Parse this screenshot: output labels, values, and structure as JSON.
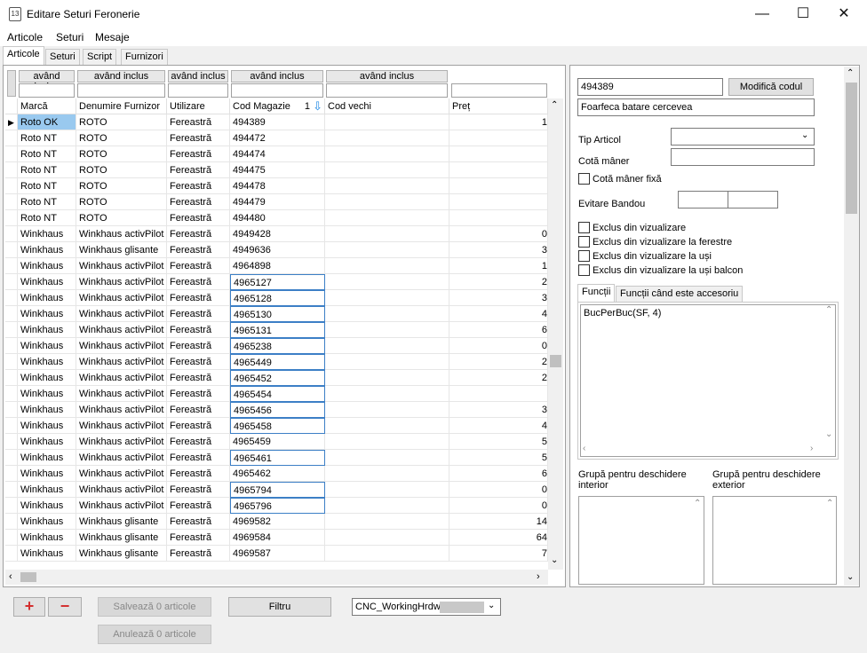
{
  "window": {
    "title": "Editare Seturi Feronerie",
    "icon_text": "13"
  },
  "menu": [
    "Articole",
    "Seturi",
    "Mesaje"
  ],
  "tabs": [
    "Articole",
    "Seturi",
    "Script",
    "Furnizori"
  ],
  "filters": {
    "labels": [
      "având inclus",
      "având inclus",
      "având inclus",
      "având inclus",
      "având inclus"
    ]
  },
  "grid": {
    "columns": [
      "Marcă",
      "Denumire Furnizor",
      "Utilizare",
      "Cod Magazie",
      "Cod vechi",
      "Preț"
    ],
    "sort_indicator": "1",
    "rows": [
      {
        "marca": "Roto OK",
        "furnizor": "ROTO",
        "utilizare": "Fereastră",
        "cod": "494389",
        "vechi": "",
        "pret": "1"
      },
      {
        "marca": "Roto NT",
        "furnizor": "ROTO",
        "utilizare": "Fereastră",
        "cod": "494472",
        "vechi": "",
        "pret": ""
      },
      {
        "marca": "Roto NT",
        "furnizor": "ROTO",
        "utilizare": "Fereastră",
        "cod": "494474",
        "vechi": "",
        "pret": ""
      },
      {
        "marca": "Roto NT",
        "furnizor": "ROTO",
        "utilizare": "Fereastră",
        "cod": "494475",
        "vechi": "",
        "pret": ""
      },
      {
        "marca": "Roto NT",
        "furnizor": "ROTO",
        "utilizare": "Fereastră",
        "cod": "494478",
        "vechi": "",
        "pret": ""
      },
      {
        "marca": "Roto NT",
        "furnizor": "ROTO",
        "utilizare": "Fereastră",
        "cod": "494479",
        "vechi": "",
        "pret": ""
      },
      {
        "marca": "Roto NT",
        "furnizor": "ROTO",
        "utilizare": "Fereastră",
        "cod": "494480",
        "vechi": "",
        "pret": ""
      },
      {
        "marca": "Winkhaus",
        "furnizor": "Winkhaus activPilot",
        "utilizare": "Fereastră",
        "cod": "4949428",
        "vechi": "",
        "pret": "0"
      },
      {
        "marca": "Winkhaus",
        "furnizor": "Winkhaus glisante",
        "utilizare": "Fereastră",
        "cod": "4949636",
        "vechi": "",
        "pret": "3"
      },
      {
        "marca": "Winkhaus",
        "furnizor": "Winkhaus activPilot",
        "utilizare": "Fereastră",
        "cod": "4964898",
        "vechi": "",
        "pret": "1"
      },
      {
        "marca": "Winkhaus",
        "furnizor": "Winkhaus activPilot",
        "utilizare": "Fereastră",
        "cod": "4965127",
        "vechi": "",
        "pret": "2"
      },
      {
        "marca": "Winkhaus",
        "furnizor": "Winkhaus activPilot",
        "utilizare": "Fereastră",
        "cod": "4965128",
        "vechi": "",
        "pret": "3"
      },
      {
        "marca": "Winkhaus",
        "furnizor": "Winkhaus activPilot",
        "utilizare": "Fereastră",
        "cod": "4965130",
        "vechi": "",
        "pret": "4"
      },
      {
        "marca": "Winkhaus",
        "furnizor": "Winkhaus activPilot",
        "utilizare": "Fereastră",
        "cod": "4965131",
        "vechi": "",
        "pret": "6"
      },
      {
        "marca": "Winkhaus",
        "furnizor": "Winkhaus activPilot",
        "utilizare": "Fereastră",
        "cod": "4965238",
        "vechi": "",
        "pret": "0"
      },
      {
        "marca": "Winkhaus",
        "furnizor": "Winkhaus activPilot",
        "utilizare": "Fereastră",
        "cod": "4965449",
        "vechi": "",
        "pret": "2"
      },
      {
        "marca": "Winkhaus",
        "furnizor": "Winkhaus activPilot",
        "utilizare": "Fereastră",
        "cod": "4965452",
        "vechi": "",
        "pret": "2"
      },
      {
        "marca": "Winkhaus",
        "furnizor": "Winkhaus activPilot",
        "utilizare": "Fereastră",
        "cod": "4965454",
        "vechi": "",
        "pret": ""
      },
      {
        "marca": "Winkhaus",
        "furnizor": "Winkhaus activPilot",
        "utilizare": "Fereastră",
        "cod": "4965456",
        "vechi": "",
        "pret": "3"
      },
      {
        "marca": "Winkhaus",
        "furnizor": "Winkhaus activPilot",
        "utilizare": "Fereastră",
        "cod": "4965458",
        "vechi": "",
        "pret": "4"
      },
      {
        "marca": "Winkhaus",
        "furnizor": "Winkhaus activPilot",
        "utilizare": "Fereastră",
        "cod": "4965459",
        "vechi": "",
        "pret": "5"
      },
      {
        "marca": "Winkhaus",
        "furnizor": "Winkhaus activPilot",
        "utilizare": "Fereastră",
        "cod": "4965461",
        "vechi": "",
        "pret": "5"
      },
      {
        "marca": "Winkhaus",
        "furnizor": "Winkhaus activPilot",
        "utilizare": "Fereastră",
        "cod": "4965462",
        "vechi": "",
        "pret": "6"
      },
      {
        "marca": "Winkhaus",
        "furnizor": "Winkhaus activPilot",
        "utilizare": "Fereastră",
        "cod": "4965794",
        "vechi": "",
        "pret": "0"
      },
      {
        "marca": "Winkhaus",
        "furnizor": "Winkhaus activPilot",
        "utilizare": "Fereastră",
        "cod": "4965796",
        "vechi": "",
        "pret": "0"
      },
      {
        "marca": "Winkhaus",
        "furnizor": "Winkhaus glisante",
        "utilizare": "Fereastră",
        "cod": "4969582",
        "vechi": "",
        "pret": "14"
      },
      {
        "marca": "Winkhaus",
        "furnizor": "Winkhaus glisante",
        "utilizare": "Fereastră",
        "cod": "4969584",
        "vechi": "",
        "pret": "64"
      },
      {
        "marca": "Winkhaus",
        "furnizor": "Winkhaus glisante",
        "utilizare": "Fereastră",
        "cod": "4969587",
        "vechi": "",
        "pret": "7"
      }
    ],
    "boxed_rows": [
      10,
      11,
      12,
      13,
      14,
      15,
      16,
      17,
      18,
      19,
      21,
      23,
      24
    ]
  },
  "bottom": {
    "add": "+",
    "remove": "−",
    "save": "Salvează 0 articole",
    "cancel": "Anulează 0 articole",
    "filter": "Filtru",
    "profile": "CNC_WorkingHrdw_"
  },
  "detail": {
    "code": "494389",
    "modify_btn": "Modifică codul",
    "description": "Foarfeca batare cercevea",
    "tip_articol_label": "Tip Articol",
    "tip_articol_value": "",
    "cota_label": "Cotă mâner",
    "cota_value": "",
    "cota_fixa_label": "Cotă mâner fixă",
    "evitare_label": "Evitare Bandou",
    "excludes": [
      "Exclus din vizualizare",
      "Exclus din vizualizare la ferestre",
      "Exclus din vizualizare la uși",
      "Exclus din vizualizare la uși balcon"
    ],
    "func_tabs": [
      "Funcții",
      "Funcții când este accesoriu"
    ],
    "func_text": "BucPerBuc(SF, 4)",
    "group_int_label": "Grupă pentru deschidere interior",
    "group_ext_label": "Grupă pentru deschidere exterior"
  },
  "colors": {
    "selected": "#99c9ef",
    "box_border": "#3c7fc6",
    "add": "#d32f2f"
  }
}
